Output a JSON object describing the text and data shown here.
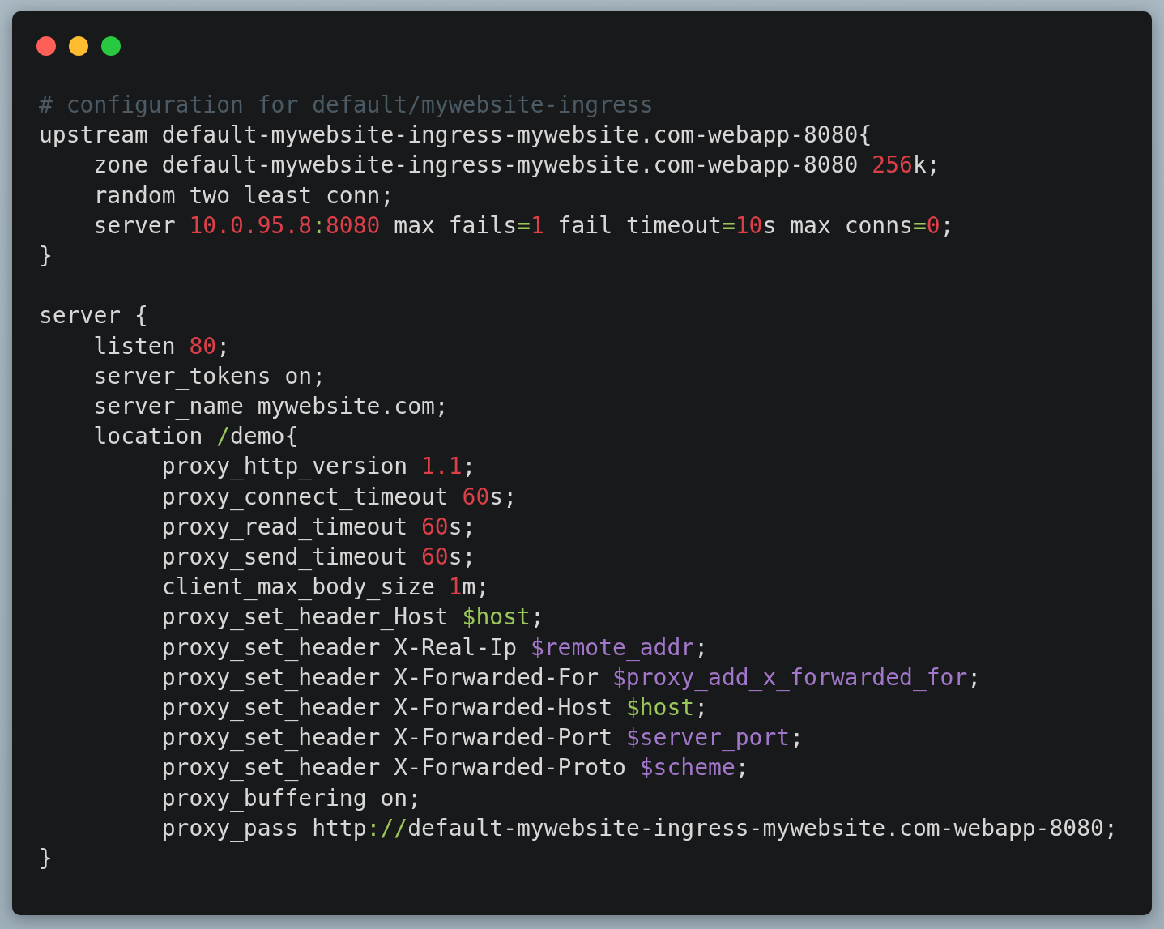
{
  "code_window": {
    "lines": [
      {
        "tokens": [
          {
            "text": "# configuration for default/mywebsite-ingress",
            "kind": "comment"
          }
        ]
      },
      {
        "tokens": [
          {
            "text": "upstream default-mywebsite-ingress-mywebsite.com-webapp-8080{",
            "kind": "plain"
          }
        ]
      },
      {
        "tokens": [
          {
            "text": "    zone default-mywebsite-ingress-mywebsite.com-webapp-8080 ",
            "kind": "plain"
          },
          {
            "text": "256",
            "kind": "number"
          },
          {
            "text": "k;",
            "kind": "plain"
          }
        ]
      },
      {
        "tokens": [
          {
            "text": "    random two least conn;",
            "kind": "plain"
          }
        ]
      },
      {
        "tokens": [
          {
            "text": "    server ",
            "kind": "plain"
          },
          {
            "text": "10.0.95.8",
            "kind": "number"
          },
          {
            "text": ":",
            "kind": "operator"
          },
          {
            "text": "8080",
            "kind": "number"
          },
          {
            "text": " max fails",
            "kind": "plain"
          },
          {
            "text": "=",
            "kind": "operator"
          },
          {
            "text": "1",
            "kind": "number"
          },
          {
            "text": " fail timeout",
            "kind": "plain"
          },
          {
            "text": "=",
            "kind": "operator"
          },
          {
            "text": "10",
            "kind": "number"
          },
          {
            "text": "s max conns",
            "kind": "plain"
          },
          {
            "text": "=",
            "kind": "operator"
          },
          {
            "text": "0",
            "kind": "number"
          },
          {
            "text": ";",
            "kind": "plain"
          }
        ]
      },
      {
        "tokens": [
          {
            "text": "}",
            "kind": "plain"
          }
        ]
      },
      {
        "gap_before": true,
        "tokens": [
          {
            "text": "server {",
            "kind": "plain"
          }
        ]
      },
      {
        "tokens": [
          {
            "text": "    listen ",
            "kind": "plain"
          },
          {
            "text": "80",
            "kind": "number"
          },
          {
            "text": ";",
            "kind": "plain"
          }
        ]
      },
      {
        "tokens": [
          {
            "text": "    server_tokens on;",
            "kind": "plain"
          }
        ]
      },
      {
        "tokens": [
          {
            "text": "    server_name mywebsite.com;",
            "kind": "plain"
          }
        ]
      },
      {
        "tokens": [
          {
            "text": "    location ",
            "kind": "plain"
          },
          {
            "text": "/",
            "kind": "operator"
          },
          {
            "text": "demo{",
            "kind": "plain"
          }
        ]
      },
      {
        "tokens": [
          {
            "text": "         proxy_http_version ",
            "kind": "plain"
          },
          {
            "text": "1.1",
            "kind": "number"
          },
          {
            "text": ";",
            "kind": "plain"
          }
        ]
      },
      {
        "tokens": [
          {
            "text": "         proxy_connect_timeout ",
            "kind": "plain"
          },
          {
            "text": "60",
            "kind": "number"
          },
          {
            "text": "s;",
            "kind": "plain"
          }
        ]
      },
      {
        "tokens": [
          {
            "text": "         proxy_read_timeout ",
            "kind": "plain"
          },
          {
            "text": "60",
            "kind": "number"
          },
          {
            "text": "s;",
            "kind": "plain"
          }
        ]
      },
      {
        "tokens": [
          {
            "text": "         proxy_send_timeout ",
            "kind": "plain"
          },
          {
            "text": "60",
            "kind": "number"
          },
          {
            "text": "s;",
            "kind": "plain"
          }
        ]
      },
      {
        "tokens": [
          {
            "text": "         client_max_body_size ",
            "kind": "plain"
          },
          {
            "text": "1",
            "kind": "number"
          },
          {
            "text": "m;",
            "kind": "plain"
          }
        ]
      },
      {
        "tokens": [
          {
            "text": "         proxy_set_header_Host ",
            "kind": "plain"
          },
          {
            "text": "$host",
            "kind": "operator"
          },
          {
            "text": ";",
            "kind": "plain"
          }
        ]
      },
      {
        "tokens": [
          {
            "text": "         proxy_set_header X-Real-Ip ",
            "kind": "plain"
          },
          {
            "text": "$remote_addr",
            "kind": "variable"
          },
          {
            "text": ";",
            "kind": "plain"
          }
        ]
      },
      {
        "tokens": [
          {
            "text": "         proxy_set_header X-Forwarded-For ",
            "kind": "plain"
          },
          {
            "text": "$proxy_add_x_forwarded_for",
            "kind": "variable"
          },
          {
            "text": ";",
            "kind": "plain"
          }
        ]
      },
      {
        "tokens": [
          {
            "text": "         proxy_set_header X-Forwarded-Host ",
            "kind": "plain"
          },
          {
            "text": "$host",
            "kind": "operator"
          },
          {
            "text": ";",
            "kind": "plain"
          }
        ]
      },
      {
        "tokens": [
          {
            "text": "         proxy_set_header X-Forwarded-Port ",
            "kind": "plain"
          },
          {
            "text": "$server_port",
            "kind": "variable"
          },
          {
            "text": ";",
            "kind": "plain"
          }
        ]
      },
      {
        "tokens": [
          {
            "text": "         proxy_set_header X-Forwarded-Proto ",
            "kind": "plain"
          },
          {
            "text": "$scheme",
            "kind": "variable"
          },
          {
            "text": ";",
            "kind": "plain"
          }
        ]
      },
      {
        "tokens": [
          {
            "text": "         proxy_buffering on;",
            "kind": "plain"
          }
        ]
      },
      {
        "tokens": [
          {
            "text": "         proxy_pass http",
            "kind": "plain"
          },
          {
            "text": "://",
            "kind": "operator"
          },
          {
            "text": "default-mywebsite-ingress-mywebsite.com-webapp-8080;",
            "kind": "plain"
          }
        ]
      },
      {
        "tokens": [
          {
            "text": "}",
            "kind": "plain"
          }
        ]
      }
    ]
  }
}
